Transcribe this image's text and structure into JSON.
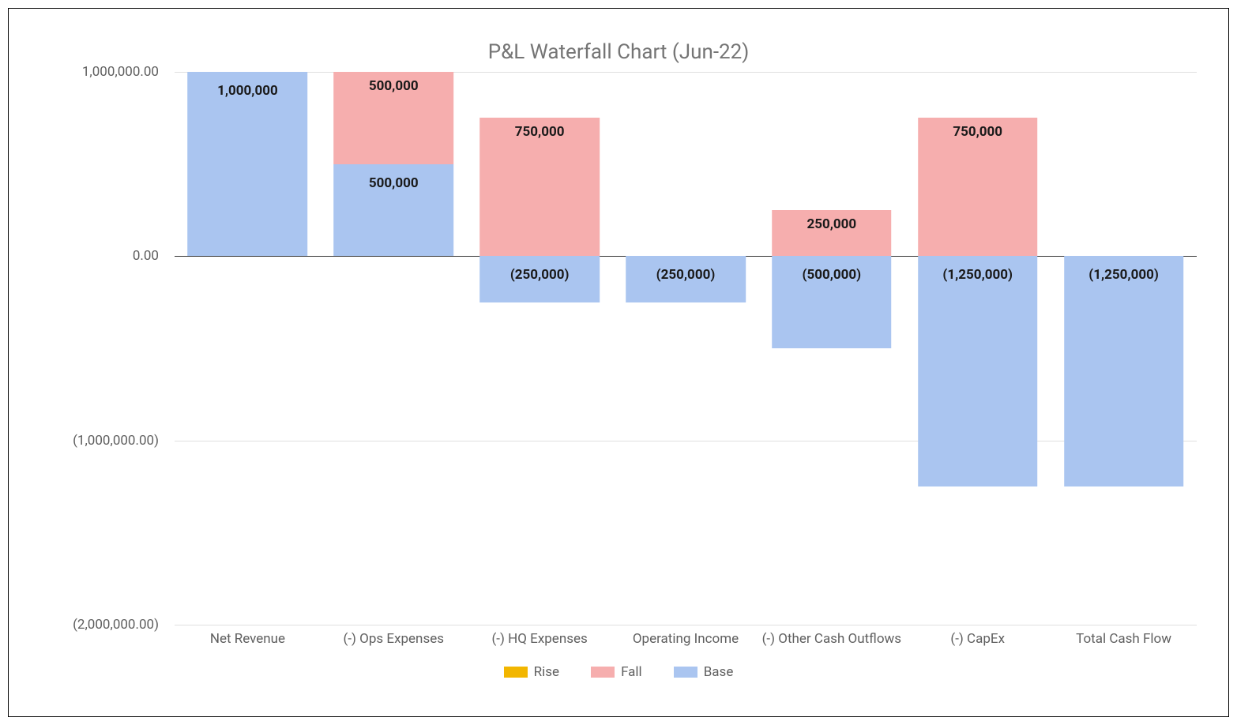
{
  "title": "P&L Waterfall Chart (Jun-22)",
  "y_ticks": [
    {
      "value": 1000000,
      "label": "1,000,000.00"
    },
    {
      "value": 0,
      "label": "0.00"
    },
    {
      "value": -1000000,
      "label": "(1,000,000.00)"
    },
    {
      "value": -2000000,
      "label": "(2,000,000.00)"
    }
  ],
  "y_range": {
    "min": -2000000,
    "max": 1000000
  },
  "categories": [
    "Net Revenue",
    "(-) Ops Expenses",
    "(-) HQ Expenses",
    "Operating Income",
    "(-) Other Cash Outflows",
    "(-) CapEx",
    "Total Cash Flow"
  ],
  "bars": [
    {
      "segments": [
        {
          "kind": "base",
          "from": 0,
          "to": 1000000,
          "label": "1,000,000"
        }
      ]
    },
    {
      "segments": [
        {
          "kind": "base",
          "from": 0,
          "to": 500000,
          "label": "500,000"
        },
        {
          "kind": "fall",
          "from": 500000,
          "to": 1000000,
          "label": "500,000"
        }
      ]
    },
    {
      "segments": [
        {
          "kind": "base",
          "from": -250000,
          "to": 0,
          "label": "(250,000)"
        },
        {
          "kind": "fall",
          "from": 0,
          "to": 750000,
          "label": "750,000"
        }
      ]
    },
    {
      "segments": [
        {
          "kind": "base",
          "from": -250000,
          "to": 0,
          "label": "(250,000)"
        }
      ]
    },
    {
      "segments": [
        {
          "kind": "base",
          "from": -500000,
          "to": 0,
          "label": "(500,000)"
        },
        {
          "kind": "fall",
          "from": 0,
          "to": 250000,
          "label": "250,000"
        }
      ]
    },
    {
      "segments": [
        {
          "kind": "base",
          "from": -1250000,
          "to": 0,
          "label": "(1,250,000)"
        },
        {
          "kind": "fall",
          "from": 0,
          "to": 750000,
          "label": "750,000"
        }
      ]
    },
    {
      "segments": [
        {
          "kind": "base",
          "from": -1250000,
          "to": 0,
          "label": "(1,250,000)"
        }
      ]
    }
  ],
  "legend": [
    {
      "kind": "rise",
      "label": "Rise"
    },
    {
      "kind": "fall",
      "label": "Fall"
    },
    {
      "kind": "base",
      "label": "Base"
    }
  ],
  "chart_data": {
    "type": "bar",
    "subtype": "waterfall-stacked",
    "title": "P&L Waterfall Chart (Jun-22)",
    "xlabel": "",
    "ylabel": "",
    "ylim": [
      -2000000,
      1000000
    ],
    "categories": [
      "Net Revenue",
      "(-) Ops Expenses",
      "(-) HQ Expenses",
      "Operating Income",
      "(-) Other Cash Outflows",
      "(-) CapEx",
      "Total Cash Flow"
    ],
    "series": [
      {
        "name": "Rise",
        "values": [
          0,
          0,
          0,
          0,
          0,
          0,
          0
        ]
      },
      {
        "name": "Fall",
        "values": [
          0,
          500000,
          750000,
          0,
          250000,
          750000,
          0
        ]
      },
      {
        "name": "Base",
        "values": [
          1000000,
          500000,
          -250000,
          -250000,
          -500000,
          -1250000,
          -1250000
        ]
      }
    ],
    "waterfall_running_total": [
      1000000,
      500000,
      -250000,
      -250000,
      -500000,
      -1250000,
      -1250000
    ]
  }
}
